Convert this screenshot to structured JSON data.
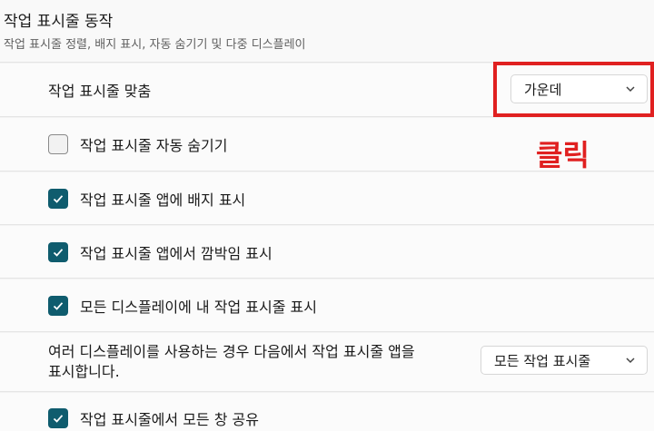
{
  "section": {
    "title": "작업 표시줄 동작",
    "subtitle": "작업 표시줄 정렬, 배지 표시, 자동 숨기기 및 다중 디스플레이"
  },
  "alignment": {
    "label": "작업 표시줄 맞춤",
    "value": "가운데"
  },
  "checkboxes": [
    {
      "label": "작업 표시줄 자동 숨기기",
      "checked": false
    },
    {
      "label": "작업 표시줄 앱에 배지 표시",
      "checked": true
    },
    {
      "label": "작업 표시줄 앱에서 깜박임 표시",
      "checked": true
    },
    {
      "label": "모든 디스플레이에 내 작업 표시줄 표시",
      "checked": true
    }
  ],
  "multi_display": {
    "label_line1": "여러 디스플레이를 사용하는 경우 다음에서 작업 표시줄 앱을",
    "label_line2": "표시합니다.",
    "value": "모든 작업 표시줄"
  },
  "share_windows": {
    "label": "작업 표시줄에서 모든 창 공유",
    "checked": true
  },
  "annotation": {
    "text": "클릭",
    "color": "#e02020"
  },
  "colors": {
    "accent": "#0f5c6e"
  },
  "icons": {
    "check": "checkmark-icon",
    "dropdown": "chevron-down-icon"
  }
}
